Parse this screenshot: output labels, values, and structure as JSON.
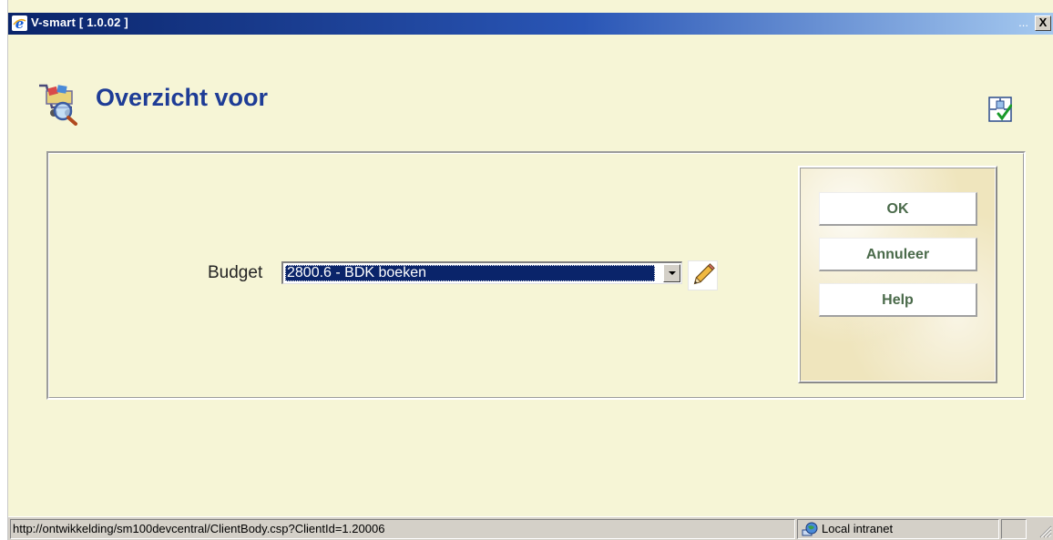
{
  "window": {
    "title": "V-smart [ 1.0.02 ]",
    "ellipsis": "...",
    "close_label": "X",
    "icon": "internet-explorer-icon"
  },
  "header": {
    "title": "Overzicht voor",
    "icon": "acquisitions-cart-magnifier-icon",
    "layout_icon": "layout-settings-icon"
  },
  "form": {
    "budget_label": "Budget",
    "budget_value": "2800.6 - BDK boeken",
    "edit_icon": "pencil-icon"
  },
  "actions": {
    "ok_label": "OK",
    "cancel_label": "Annuleer",
    "help_label": "Help"
  },
  "statusbar": {
    "url": "http://ontwikkelding/sm100devcentral/ClientBody.csp?ClientId=1.20006",
    "zone": "Local intranet",
    "zone_icon": "local-intranet-globe-icon"
  },
  "colors": {
    "background": "#f6f5d6",
    "title_text": "#1e3c96",
    "titlebar_start": "#0a246a",
    "titlebar_end": "#a6caf0",
    "selection": "#0a246a",
    "button_text": "#4a6a4a"
  }
}
